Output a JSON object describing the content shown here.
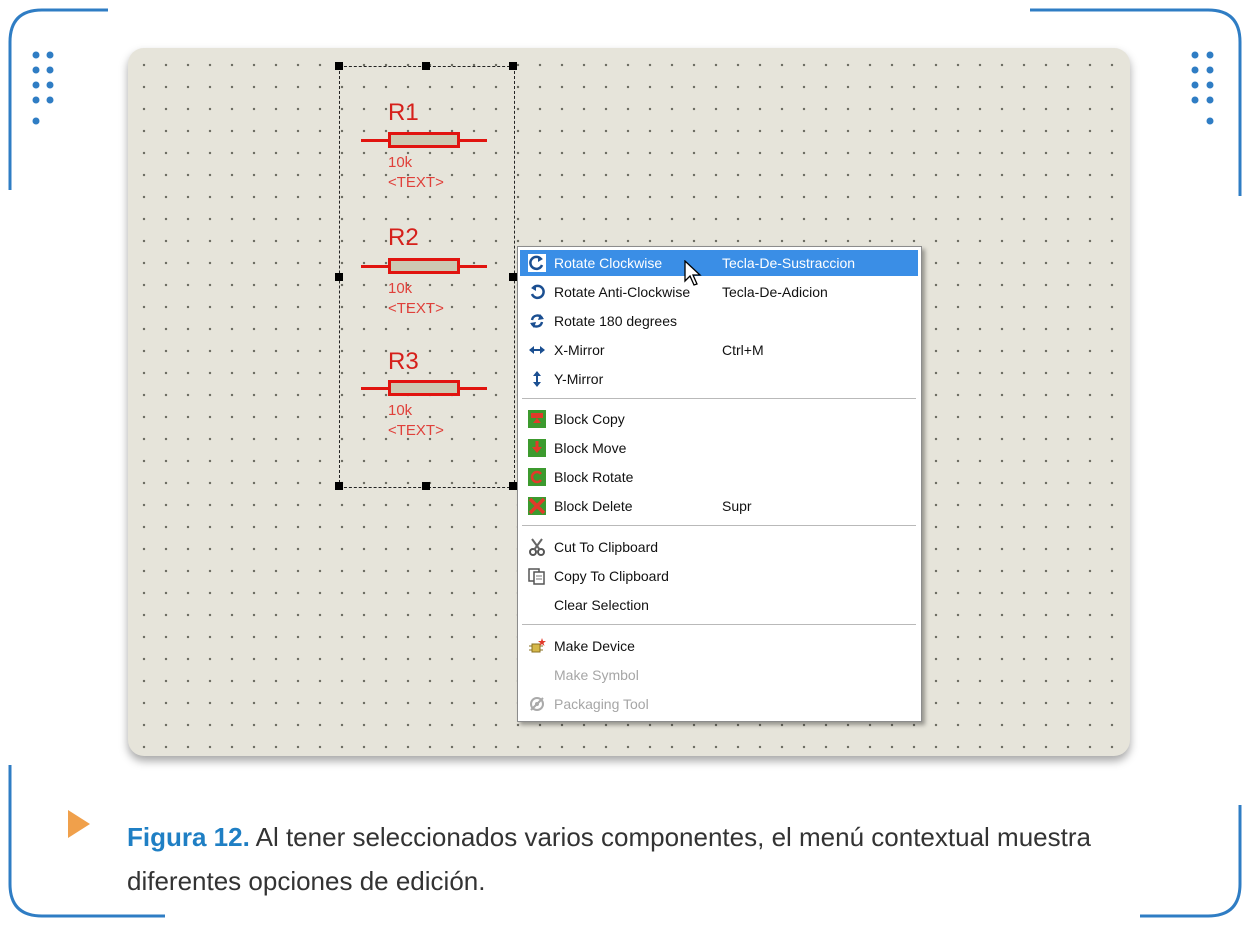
{
  "schematic": {
    "components": [
      {
        "name": "R1",
        "value": "10k",
        "text": "<TEXT>"
      },
      {
        "name": "R2",
        "value": "10k",
        "text": "<TEXT>"
      },
      {
        "name": "R3",
        "value": "10k",
        "text": "<TEXT>"
      }
    ]
  },
  "context_menu": {
    "items": [
      {
        "label": "Rotate Clockwise",
        "shortcut": "Tecla-De-Sustraccion",
        "icon": "rotate-clockwise-icon",
        "highlighted": true
      },
      {
        "label": "Rotate Anti-Clockwise",
        "shortcut": "Tecla-De-Adicion",
        "icon": "rotate-anticlockwise-icon"
      },
      {
        "label": "Rotate 180 degrees",
        "shortcut": "",
        "icon": "rotate-180-icon"
      },
      {
        "label": "X-Mirror",
        "shortcut": "Ctrl+M",
        "icon": "x-mirror-icon"
      },
      {
        "label": "Y-Mirror",
        "shortcut": "",
        "icon": "y-mirror-icon"
      },
      {
        "label": "Block Copy",
        "shortcut": "",
        "icon": "block-copy-icon"
      },
      {
        "label": "Block Move",
        "shortcut": "",
        "icon": "block-move-icon"
      },
      {
        "label": "Block Rotate",
        "shortcut": "",
        "icon": "block-rotate-icon"
      },
      {
        "label": "Block Delete",
        "shortcut": "Supr",
        "icon": "block-delete-icon"
      },
      {
        "label": "Cut To Clipboard",
        "shortcut": "",
        "icon": "scissors-icon"
      },
      {
        "label": "Copy To Clipboard",
        "shortcut": "",
        "icon": "copy-icon"
      },
      {
        "label": "Clear Selection",
        "shortcut": "",
        "icon": ""
      },
      {
        "label": "Make Device",
        "shortcut": "",
        "icon": "make-device-icon"
      },
      {
        "label": "Make Symbol",
        "shortcut": "",
        "icon": "",
        "disabled": true
      },
      {
        "label": "Packaging Tool",
        "shortcut": "",
        "icon": "packaging-tool-icon",
        "disabled": true
      }
    ]
  },
  "caption": {
    "figure_label": "Figura 12.",
    "text": " Al tener seleccionados varios componentes, el menú contextual muestra diferentes opciones de edición."
  },
  "colors": {
    "accent_blue": "#1f7fc4",
    "menu_highlight": "#3a8ee6",
    "component_red": "#e1140f",
    "canvas_bg": "#e6e4da",
    "arrow_orange": "#f0a04b"
  }
}
